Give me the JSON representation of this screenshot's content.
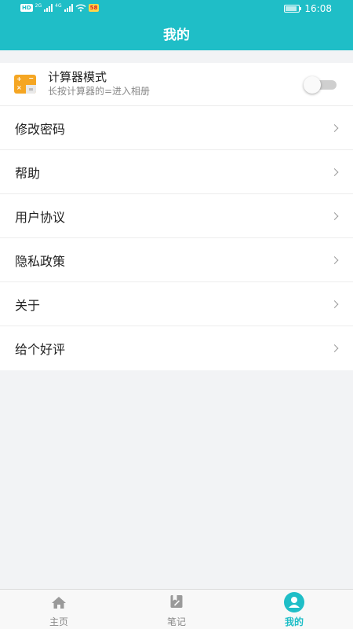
{
  "status_bar": {
    "time": "16:08"
  },
  "header": {
    "title": "我的"
  },
  "calculator_mode": {
    "title": "计算器模式",
    "subtitle": "长按计算器的=进入相册",
    "enabled": false,
    "icon": "calculator-icon"
  },
  "menu": [
    {
      "label": "修改密码"
    },
    {
      "label": "帮助"
    },
    {
      "label": "用户协议"
    },
    {
      "label": "隐私政策"
    },
    {
      "label": "关于"
    },
    {
      "label": "给个好评"
    }
  ],
  "tabs": [
    {
      "label": "主页",
      "icon": "home-icon",
      "active": false
    },
    {
      "label": "笔记",
      "icon": "note-icon",
      "active": false
    },
    {
      "label": "我的",
      "icon": "profile-icon",
      "active": true
    }
  ],
  "colors": {
    "accent": "#1fbec7",
    "calculator_icon": "#f5a623",
    "background": "#f2f3f5"
  }
}
